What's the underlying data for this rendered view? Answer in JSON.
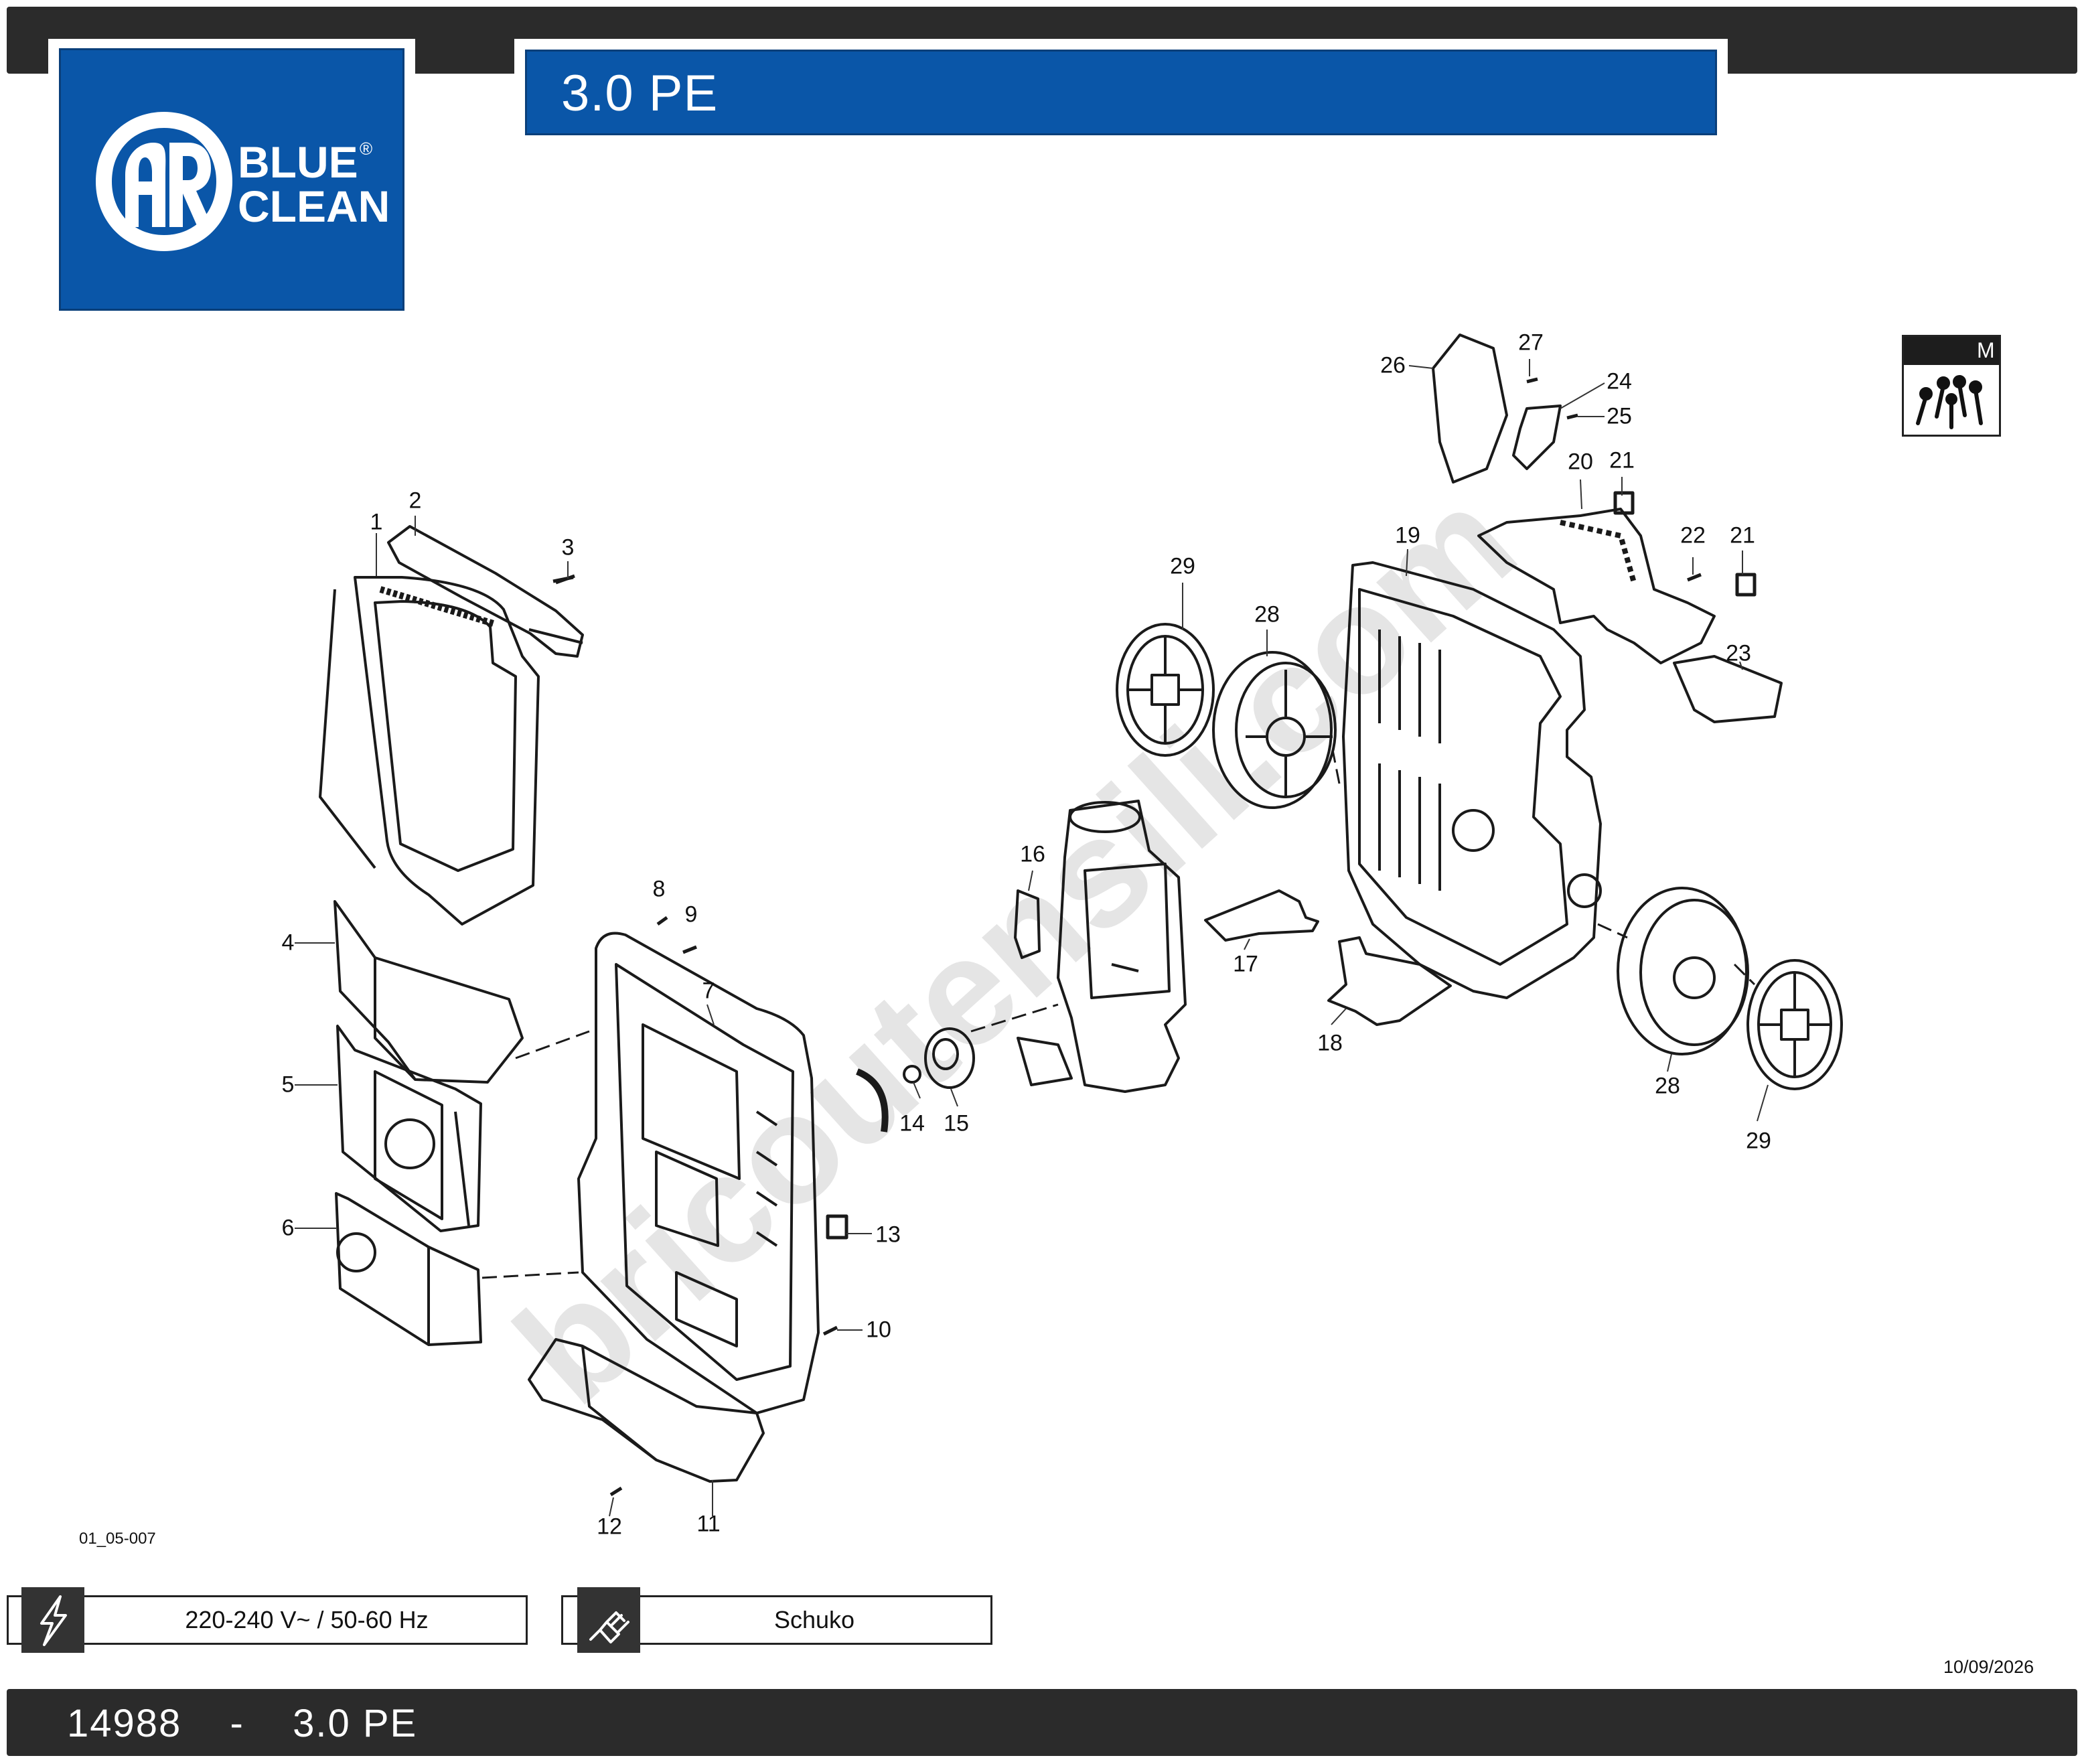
{
  "header": {
    "title": "3.0 PE"
  },
  "logo": {
    "monogram": "AR",
    "line1": "BLUE",
    "line2": "CLEAN",
    "registered": "®"
  },
  "kit_badge": {
    "letter": "M",
    "icon": "screws-icon"
  },
  "diagram": {
    "drawing_code": "01_05-007",
    "watermark": "bricoutensili.com",
    "part_labels": [
      "1",
      "2",
      "3",
      "4",
      "5",
      "6",
      "7",
      "8",
      "9",
      "10",
      "11",
      "12",
      "13",
      "14",
      "15",
      "16",
      "17",
      "18",
      "19",
      "20",
      "21",
      "21",
      "22",
      "23",
      "24",
      "25",
      "26",
      "27",
      "28",
      "28",
      "29",
      "29"
    ]
  },
  "specs": {
    "power": {
      "icon": "lightning-icon",
      "text": "220-240 V~ / 50-60 Hz"
    },
    "plug": {
      "icon": "plug-icon",
      "text": "Schuko"
    }
  },
  "date": "10/09/2026",
  "footer": {
    "code": "14988",
    "separator": "-",
    "model": "3.0 PE"
  },
  "colors": {
    "brand_blue": "#0a56a8",
    "band_dark": "#2b2b2b"
  }
}
